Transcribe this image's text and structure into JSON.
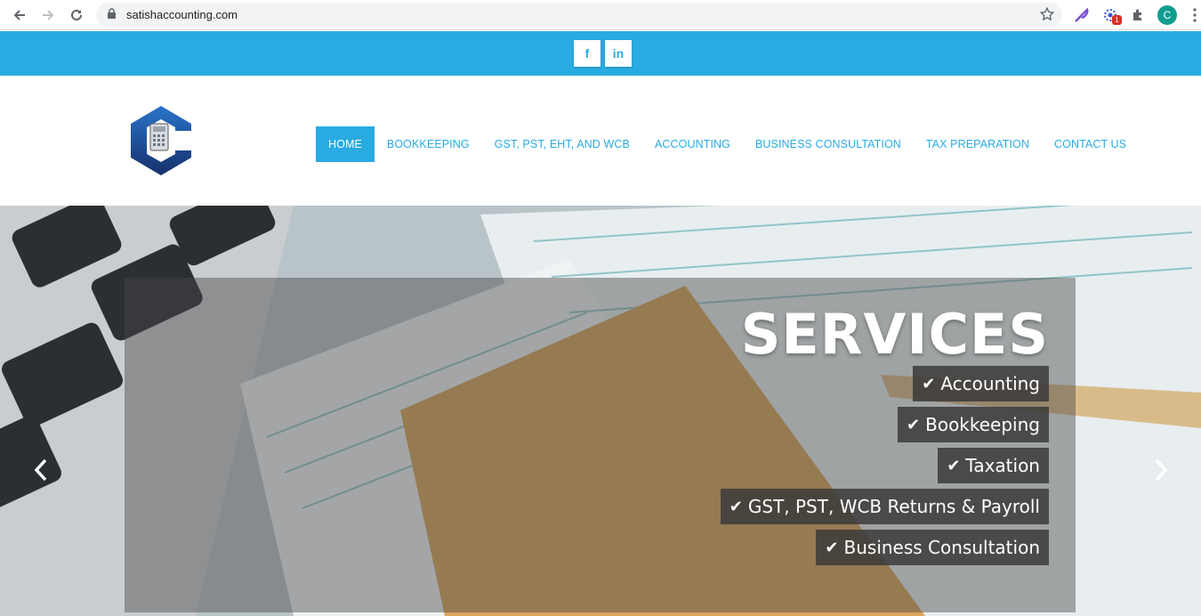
{
  "browser": {
    "url": "satishaccounting.com",
    "profile_initial": "C",
    "extension_badge": "1",
    "icons": [
      "back-icon",
      "forward-icon",
      "reload-icon",
      "lock-icon",
      "star-icon",
      "feather-icon",
      "extension-icon",
      "puzzle-icon",
      "menu-dots-icon"
    ]
  },
  "social": {
    "facebook": "f",
    "linkedin": "in"
  },
  "nav": {
    "items": [
      {
        "label": "HOME",
        "active": true
      },
      {
        "label": "BOOKKEEPING"
      },
      {
        "label": "GST, PST, EHT, AND WCB"
      },
      {
        "label": "ACCOUNTING"
      },
      {
        "label": "BUSINESS CONSULTATION"
      },
      {
        "label": "TAX PREPARATION"
      },
      {
        "label": "CONTACT US"
      }
    ]
  },
  "hero": {
    "title": "SERVICES",
    "services": [
      "Accounting",
      "Bookkeeping",
      "Taxation",
      "GST, PST, WCB Returns & Payroll",
      "Business Consultation"
    ],
    "prev_arrow": "‹",
    "next_arrow": "›"
  },
  "colors": {
    "brand_blue": "#29abe2",
    "logo_dark": "#1d3f7a"
  }
}
